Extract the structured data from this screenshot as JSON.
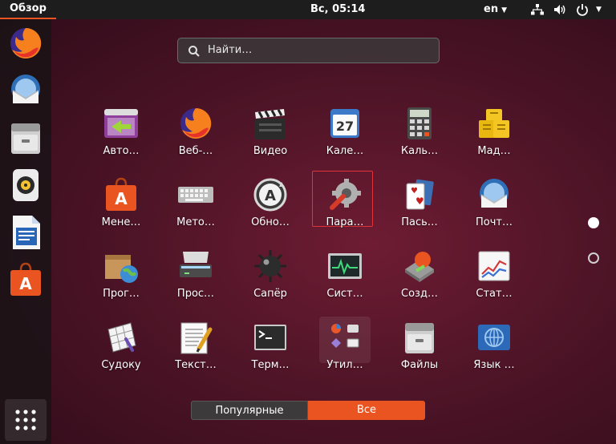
{
  "topbar": {
    "activities": "Обзор",
    "clock": "Вс, 05:14",
    "language": "en"
  },
  "dock": {
    "items": [
      {
        "icon": "firefox-icon"
      },
      {
        "icon": "thunderbird-icon"
      },
      {
        "icon": "files-icon"
      },
      {
        "icon": "rhythmbox-icon"
      },
      {
        "icon": "libreoffice-writer-icon"
      },
      {
        "icon": "ubuntu-software-icon"
      }
    ],
    "show_apps_icon": "app-grid-icon"
  },
  "search": {
    "placeholder": "Найти…"
  },
  "apps": [
    {
      "label": "Авто…",
      "icon": "startup-applications-icon"
    },
    {
      "label": "Веб-…",
      "icon": "firefox-icon"
    },
    {
      "label": "Видео",
      "icon": "videos-clapperboard-icon"
    },
    {
      "label": "Кале…",
      "icon": "calendar-icon"
    },
    {
      "label": "Каль…",
      "icon": "calculator-icon"
    },
    {
      "label": "Мад…",
      "icon": "mahjongg-icon"
    },
    {
      "label": "Мене…",
      "icon": "software-center-icon"
    },
    {
      "label": "Мето…",
      "icon": "keyboard-icon"
    },
    {
      "label": "Обно…",
      "icon": "software-updater-icon"
    },
    {
      "label": "Пара…",
      "icon": "settings-gear-icon",
      "selected": true
    },
    {
      "label": "Пась…",
      "icon": "solitaire-cards-icon"
    },
    {
      "label": "Почт…",
      "icon": "thunderbird-icon"
    },
    {
      "label": "Прог…",
      "icon": "software-box-globe-icon"
    },
    {
      "label": "Прос…",
      "icon": "scanner-icon"
    },
    {
      "label": "Сапёр",
      "icon": "mines-icon"
    },
    {
      "label": "Сист…",
      "icon": "system-monitor-icon"
    },
    {
      "label": "Созд…",
      "icon": "startup-disk-creator-icon"
    },
    {
      "label": "Стат…",
      "icon": "power-statistics-icon"
    },
    {
      "label": "Судоку",
      "icon": "sudoku-icon"
    },
    {
      "label": "Текст…",
      "icon": "text-editor-icon"
    },
    {
      "label": "Терм…",
      "icon": "terminal-icon"
    },
    {
      "label": "Утил…",
      "icon": "utilities-folder-icon"
    },
    {
      "label": "Файлы",
      "icon": "files-icon"
    },
    {
      "label": "Язык …",
      "icon": "language-support-icon"
    }
  ],
  "pages": {
    "current": 1,
    "total": 2
  },
  "view_switch": {
    "frequent": "Популярные",
    "all": "Все",
    "active": "all"
  },
  "colors": {
    "accent": "#e95420",
    "selection_border": "#e0333a",
    "topbar": "#1d1d1d"
  }
}
